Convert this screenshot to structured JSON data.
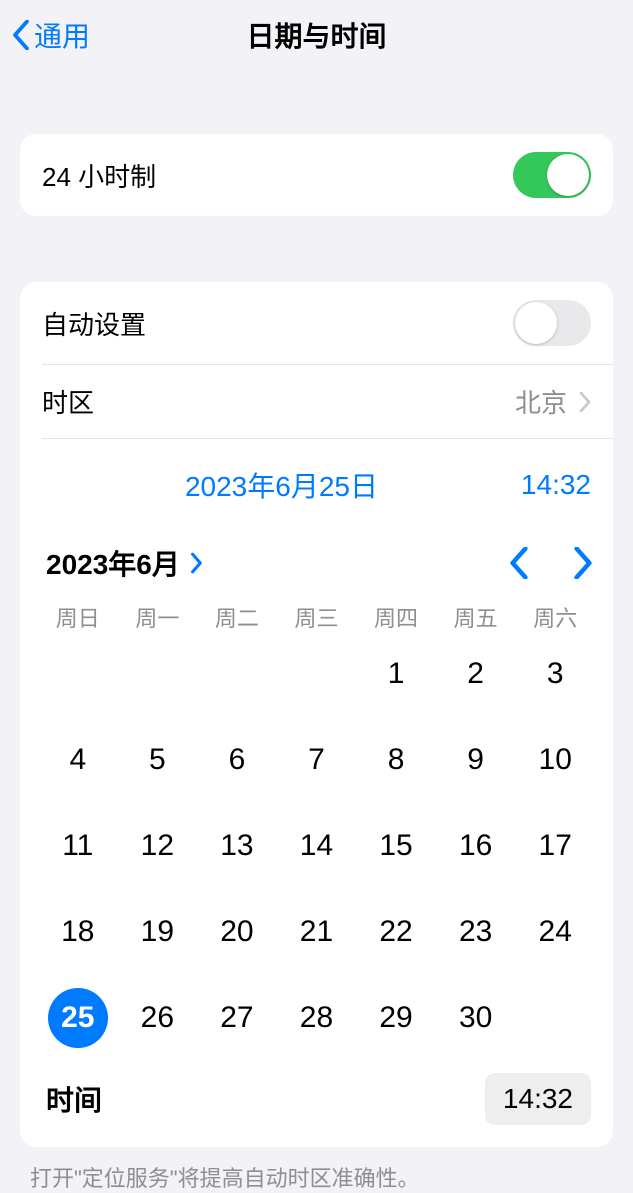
{
  "nav": {
    "back_label": "通用",
    "title": "日期与时间"
  },
  "settings": {
    "hour24_label": "24 小时制",
    "hour24_on": true,
    "auto_set_label": "自动设置",
    "auto_set_on": false,
    "timezone_label": "时区",
    "timezone_value": "北京"
  },
  "summary": {
    "date": "2023年6月25日",
    "time": "14:32"
  },
  "calendar": {
    "month_label": "2023年6月",
    "weekdays": [
      "周日",
      "周一",
      "周二",
      "周三",
      "周四",
      "周五",
      "周六"
    ],
    "leading_blanks": 4,
    "days_in_month": 30,
    "selected_day": 25
  },
  "time_row": {
    "label": "时间",
    "value": "14:32"
  },
  "footer": "打开\"定位服务\"将提高自动时区准确性。"
}
